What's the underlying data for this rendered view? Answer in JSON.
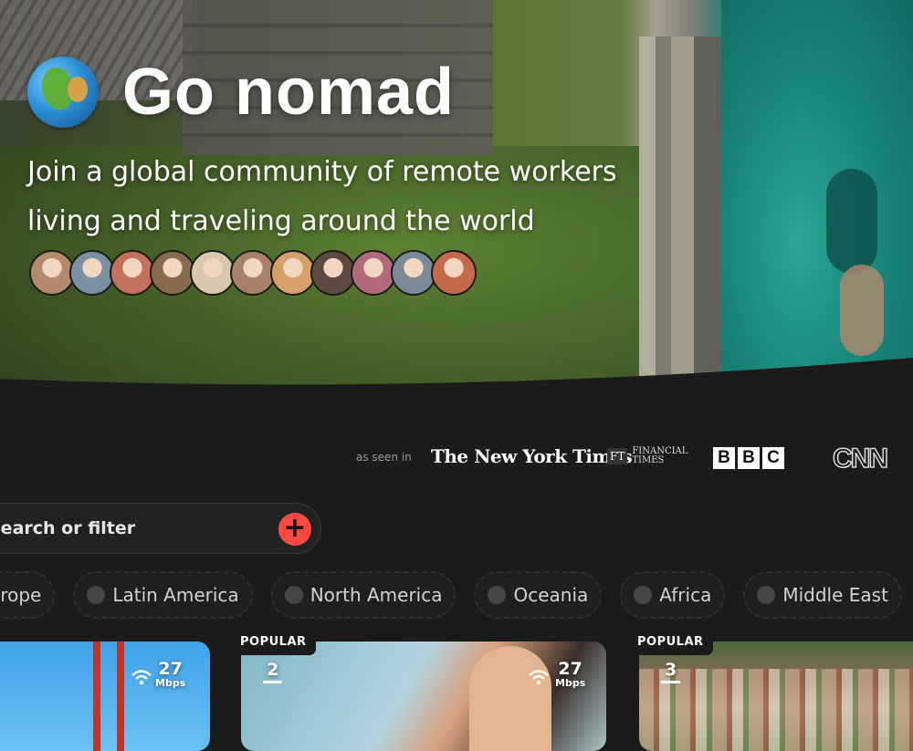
{
  "hero": {
    "title": "Go nomad",
    "globe_icon": "globe-europe-africa-emoji",
    "subtitle_line1": "Join a global community of remote workers",
    "subtitle_line2": "living and traveling around the world",
    "avatar_colors": [
      "#b48a6c",
      "#7c8fa3",
      "#c3705c",
      "#8a6a4e",
      "#d9c8b0",
      "#a8806a",
      "#d6a06b",
      "#5a4a40",
      "#b26a7a",
      "#7a8a96",
      "#c46a4a"
    ]
  },
  "press": {
    "label": "as seen in",
    "nyt": "The New York Times",
    "ft_mark": "FT",
    "ft_line1": "FINANCIAL",
    "ft_line2": "TIMES",
    "bbc": [
      "B",
      "B",
      "C"
    ],
    "cnn": "CNN"
  },
  "search": {
    "placeholder": "Search or filter",
    "add_icon": "plus-icon",
    "add_color": "#ff4742"
  },
  "regions": [
    {
      "label": "Europe",
      "icon": "none"
    },
    {
      "label": "Latin America",
      "icon": "dancer-icon"
    },
    {
      "label": "North America",
      "icon": "globe-americas-icon"
    },
    {
      "label": "Oceania",
      "icon": "surfer-icon"
    },
    {
      "label": "Africa",
      "icon": "globe-africa-icon"
    },
    {
      "label": "Middle East",
      "icon": "mosque-icon"
    }
  ],
  "cards": [
    {
      "badge": "",
      "rank": "",
      "speed": "27",
      "unit": "Mbps"
    },
    {
      "badge": "POPULAR",
      "rank": "2",
      "speed": "27",
      "unit": "Mbps"
    },
    {
      "badge": "POPULAR",
      "rank": "3",
      "speed": "",
      "unit": ""
    }
  ]
}
